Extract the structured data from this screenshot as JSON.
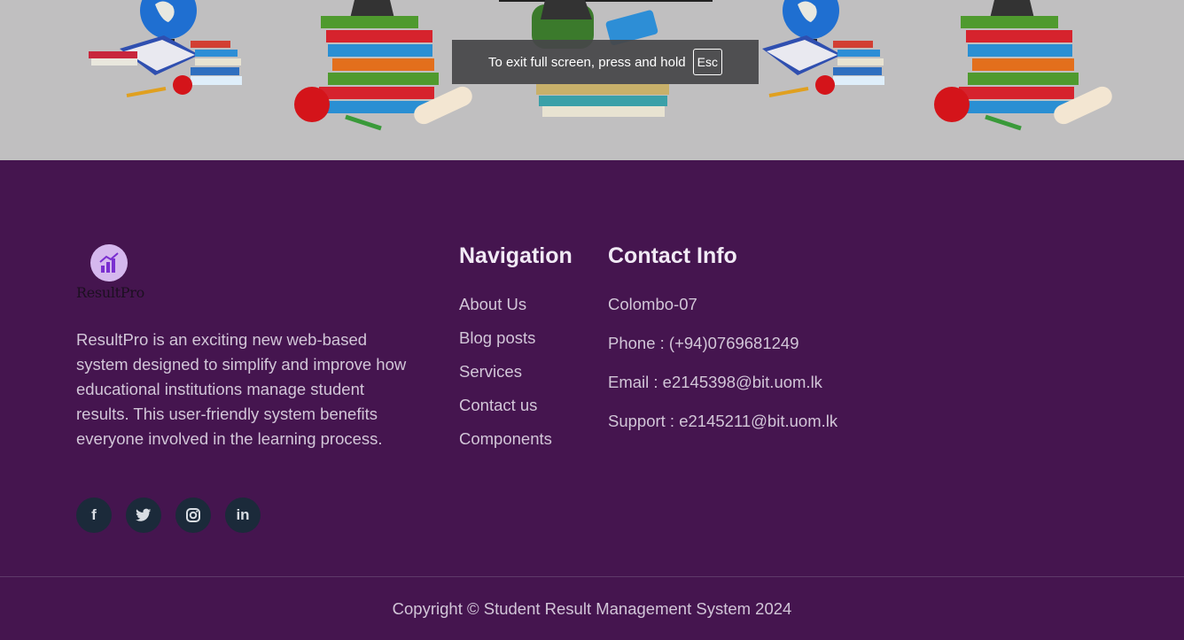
{
  "toast": {
    "text": "To exit full screen, press and hold",
    "key": "Esc"
  },
  "logo": {
    "icon": "chart-growth-icon",
    "text": "ResultPro"
  },
  "about": {
    "description": "ResultPro is an exciting new web-based system designed to simplify and improve how educational institutions manage student results. This user-friendly system benefits everyone involved in the learning process."
  },
  "socials": [
    {
      "icon": "facebook-icon",
      "glyph": "f"
    },
    {
      "icon": "twitter-icon",
      "glyph": "t"
    },
    {
      "icon": "instagram-icon",
      "glyph": "◎"
    },
    {
      "icon": "linkedin-icon",
      "glyph": "in"
    }
  ],
  "navigation": {
    "heading": "Navigation",
    "items": [
      "About Us",
      "Blog posts",
      "Services",
      "Contact us",
      "Components"
    ]
  },
  "contact": {
    "heading": "Contact Info",
    "address": "Colombo-07",
    "phone": "Phone : (+94)0769681249",
    "email": "Email : e2145398@bit.uom.lk",
    "support": "Support : e2145211@bit.uom.lk"
  },
  "footer": {
    "copyright": "Copyright © Student Result Management System 2024"
  },
  "colors": {
    "footer_bg": "#45154f",
    "banner_bg": "#c0bfc0",
    "text": "#d2c6d8",
    "social_bg": "#1b2a3a"
  }
}
